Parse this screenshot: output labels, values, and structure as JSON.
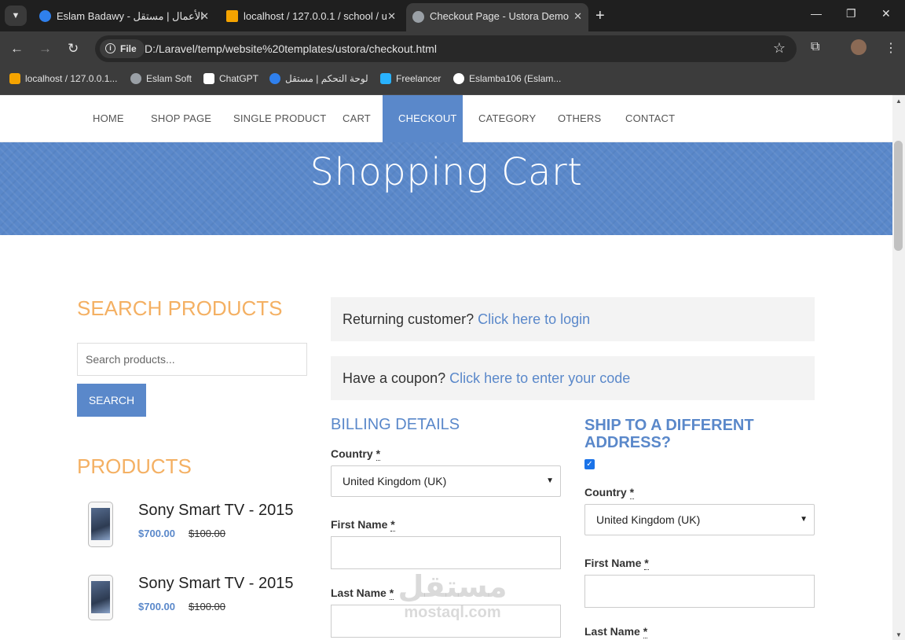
{
  "browser": {
    "tabs": [
      {
        "title": "Eslam Badawy - الأعمال | مستقل",
        "favicon_color": "#2f80ed"
      },
      {
        "title": "localhost / 127.0.0.1 / school / u",
        "favicon_color": "#f4a300"
      },
      {
        "title": "Checkout Page - Ustora Demo",
        "favicon_color": "#9aa0a6"
      }
    ],
    "file_chip": "File",
    "url": "D:/Laravel/temp/website%20templates/ustora/checkout.html",
    "bookmarks": [
      {
        "label": "localhost / 127.0.0.1...",
        "color": "#f4a300"
      },
      {
        "label": "Eslam Soft",
        "color": "#9aa0a6"
      },
      {
        "label": "ChatGPT",
        "color": "#ffffff"
      },
      {
        "label": "لوحة التحكم | مستقل",
        "color": "#2f80ed"
      },
      {
        "label": "Freelancer",
        "color": "#29b2fe"
      },
      {
        "label": "Eslamba106 (Eslam...",
        "color": "#ffffff"
      }
    ]
  },
  "menu": {
    "items": [
      "HOME",
      "SHOP PAGE",
      "SINGLE PRODUCT",
      "CART",
      "CHECKOUT",
      "CATEGORY",
      "OTHERS",
      "CONTACT"
    ],
    "active": "CHECKOUT"
  },
  "banner": {
    "title": "Shopping Cart"
  },
  "sidebar": {
    "search_heading": "SEARCH PRODUCTS",
    "search_placeholder": "Search products...",
    "search_button": "SEARCH",
    "products_heading": "PRODUCTS",
    "products": [
      {
        "name": "Sony Smart TV - 2015",
        "price": "$700.00",
        "old_price": "$100.00"
      },
      {
        "name": "Sony Smart TV - 2015",
        "price": "$700.00",
        "old_price": "$100.00"
      }
    ]
  },
  "checkout": {
    "returning_text": "Returning customer?",
    "returning_link": "Click here to login",
    "coupon_text": "Have a coupon?",
    "coupon_link": "Click here to enter your code",
    "billing_title": "BILLING DETAILS",
    "ship_title": "SHIP TO A DIFFERENT ADDRESS?",
    "ship_checked": true,
    "required_mark": "*",
    "labels": {
      "country": "Country",
      "first_name": "First Name",
      "last_name": "Last Name"
    },
    "billing_country": "United Kingdom (UK)",
    "shipping_country": "United Kingdom (UK)"
  },
  "watermark": {
    "arabic": "مستقل",
    "latin": "mostaql.com"
  },
  "colors": {
    "accent": "#5a88ca",
    "heading_orange": "#f4b063"
  }
}
